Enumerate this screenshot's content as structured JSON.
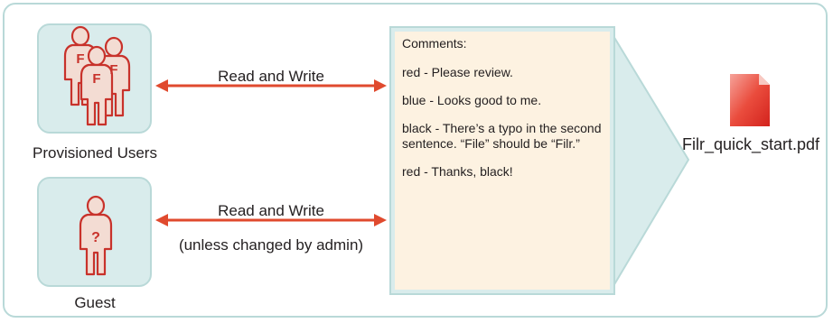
{
  "groups": {
    "provisioned": {
      "label": "Provisioned Users",
      "icon": "users-group-icon",
      "icon_letter": "F"
    },
    "guest": {
      "label": "Guest",
      "icon": "guest-user-icon",
      "icon_letter": "?"
    }
  },
  "links": {
    "provisioned_access": "Read and Write",
    "guest_access": "Read and Write",
    "guest_access_note": "(unless changed by admin)"
  },
  "comments_panel": {
    "heading": "Comments:",
    "entries": [
      "red - Please review.",
      "blue - Looks good to me.",
      "black - There’s a typo in the second sentence. “File” should be “Filr.”",
      "red - Thanks, black!"
    ]
  },
  "file": {
    "name": "Filr_quick_start.pdf",
    "icon": "pdf-file-icon"
  },
  "colors": {
    "frame_border": "#b9d9d8",
    "box_fill": "#d9ecec",
    "arrow": "#e04a2e",
    "comments_fill": "#fdf2e1",
    "callout_fill": "#d9ecec",
    "user_red": "#c8322b",
    "user_fill": "#f3dcd3"
  }
}
